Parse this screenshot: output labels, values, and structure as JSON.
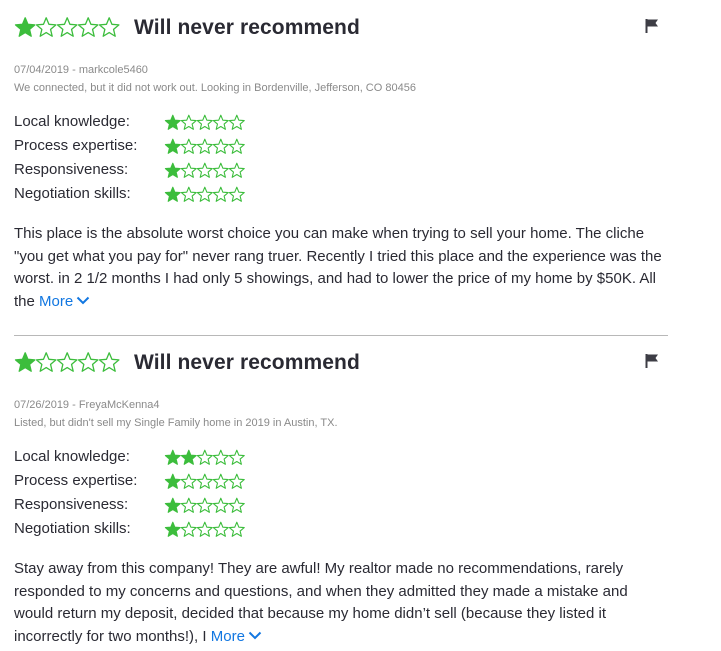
{
  "colors": {
    "star": "#3cbd3c",
    "link": "#1277e1",
    "meta": "#8a8a8a",
    "text": "#2a2a33"
  },
  "reviews": [
    {
      "overall_rating": 1,
      "headline": "Will never recommend",
      "date_user": "07/04/2019 - markcole5460",
      "context": "We connected, but it did not work out. Looking in Bordenville, Jefferson, CO 80456",
      "ratings": [
        {
          "label": "Local knowledge:",
          "value": 1
        },
        {
          "label": "Process expertise:",
          "value": 1
        },
        {
          "label": "Responsiveness:",
          "value": 1
        },
        {
          "label": "Negotiation skills:",
          "value": 1
        }
      ],
      "text": "This place is the absolute worst choice you can make when trying to sell your home. The cliche \"you get what you pay for\" never rang truer. Recently I tried this place and the experience was the worst. in 2 1/2 months I had only 5 showings, and had to lower the price of my home by $50K. All the",
      "more_label": "More",
      "flag_icon": "flag-icon"
    },
    {
      "overall_rating": 1,
      "headline": "Will never recommend",
      "date_user": "07/26/2019 - FreyaMcKenna4",
      "context": "Listed, but didn't sell my Single Family home in 2019 in Austin, TX.",
      "ratings": [
        {
          "label": "Local knowledge:",
          "value": 2
        },
        {
          "label": "Process expertise:",
          "value": 1
        },
        {
          "label": "Responsiveness:",
          "value": 1
        },
        {
          "label": "Negotiation skills:",
          "value": 1
        }
      ],
      "text": "Stay away from this company! They are awful! My realtor made no recommendations, rarely responded to my concerns and questions, and when they admitted they made a mistake and would return my deposit, decided that because my home didn’t sell (because they listed it incorrectly for two months!), I",
      "more_label": "More",
      "flag_icon": "flag-icon"
    }
  ]
}
